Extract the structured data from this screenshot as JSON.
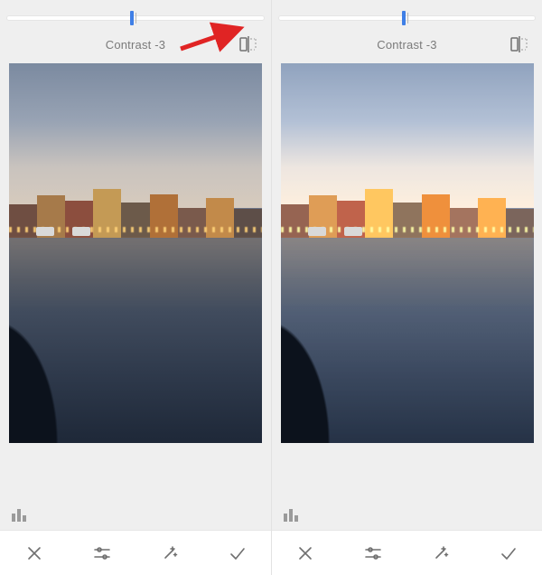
{
  "slider": {
    "center_pct": 50,
    "thumb_pct": 48
  },
  "adjustment": {
    "label": "Contrast -3"
  },
  "annotation": {
    "show_arrow_on_left_pane": true
  },
  "icons": {
    "compare": "compare-before-after-icon",
    "histogram": "histogram-icon",
    "cancel": "close-icon",
    "tune": "tune-sliders-icon",
    "wand": "magic-wand-icon",
    "apply": "checkmark-icon"
  }
}
